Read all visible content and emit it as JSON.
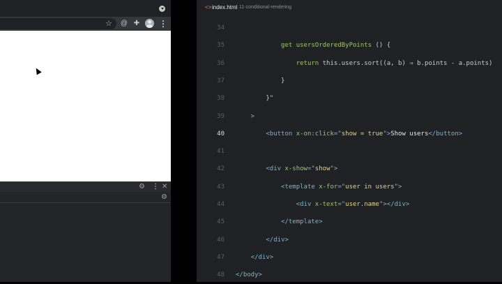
{
  "browser": {
    "omnibox_value": "",
    "icons": {
      "profile": "profile-dropdown-icon",
      "bookmark": "star-icon",
      "extension1": "at-icon",
      "extension2": "puzzle-icon",
      "account": "avatar-icon",
      "menu": "kebab-menu-icon"
    },
    "devtools": {
      "settings_icon": "gear-icon",
      "menu_icon": "kebab-menu-icon",
      "close_icon": "close-icon",
      "close_glyph": "✕",
      "settings_glyph": "⚙",
      "menu_glyph": "⋮"
    }
  },
  "editor": {
    "tab": {
      "icon": "<>",
      "filename": "index.html",
      "folder": "11-conditional-rendering"
    },
    "active_line": 40,
    "lines": [
      {
        "number": "34",
        "indent": 0,
        "tokens": []
      },
      {
        "number": "35",
        "indent": 0,
        "tokens": [
          {
            "t": "            ",
            "c": "plain"
          },
          {
            "t": "get ",
            "c": "attr"
          },
          {
            "t": "usersOrderedByPoints ",
            "c": "fn"
          },
          {
            "t": "() {",
            "c": "plain"
          }
        ]
      },
      {
        "number": "36",
        "indent": 0,
        "tokens": [
          {
            "t": "                ",
            "c": "plain"
          },
          {
            "t": "return ",
            "c": "attr"
          },
          {
            "t": "this.users.sort((a, b) ⇒ b.points - a.points)",
            "c": "plain"
          }
        ]
      },
      {
        "number": "37",
        "indent": 0,
        "tokens": [
          {
            "t": "            }",
            "c": "plain"
          }
        ]
      },
      {
        "number": "38",
        "indent": 0,
        "tokens": [
          {
            "t": "        }\"",
            "c": "plain"
          }
        ]
      },
      {
        "number": "39",
        "indent": 0,
        "tokens": [
          {
            "t": "    >",
            "c": "tag"
          }
        ]
      },
      {
        "number": "40",
        "indent": 0,
        "tokens": [
          {
            "t": "        ",
            "c": "plain"
          },
          {
            "t": "<button ",
            "c": "tag"
          },
          {
            "t": "x-on:click",
            "c": "attr"
          },
          {
            "t": "=\"",
            "c": "tag"
          },
          {
            "t": "show = true",
            "c": "str"
          },
          {
            "t": "\">",
            "c": "tag"
          },
          {
            "t": "Show users",
            "c": "white"
          },
          {
            "t": "</button>",
            "c": "tag"
          }
        ]
      },
      {
        "number": "41",
        "indent": 0,
        "tokens": []
      },
      {
        "number": "42",
        "indent": 0,
        "tokens": [
          {
            "t": "        ",
            "c": "plain"
          },
          {
            "t": "<div ",
            "c": "tag"
          },
          {
            "t": "x-show",
            "c": "attr"
          },
          {
            "t": "=\"",
            "c": "tag"
          },
          {
            "t": "show",
            "c": "str"
          },
          {
            "t": "\">",
            "c": "tag"
          }
        ]
      },
      {
        "number": "43",
        "indent": 0,
        "tokens": [
          {
            "t": "            ",
            "c": "plain"
          },
          {
            "t": "<template ",
            "c": "tag"
          },
          {
            "t": "x-for",
            "c": "attr"
          },
          {
            "t": "=\"",
            "c": "tag"
          },
          {
            "t": "user in users",
            "c": "str"
          },
          {
            "t": "\">",
            "c": "tag"
          }
        ]
      },
      {
        "number": "44",
        "indent": 0,
        "tokens": [
          {
            "t": "                ",
            "c": "plain"
          },
          {
            "t": "<div ",
            "c": "tag"
          },
          {
            "t": "x-text",
            "c": "attr"
          },
          {
            "t": "=\"",
            "c": "tag"
          },
          {
            "t": "user.name",
            "c": "str"
          },
          {
            "t": "\"></div>",
            "c": "tag"
          }
        ]
      },
      {
        "number": "45",
        "indent": 0,
        "tokens": [
          {
            "t": "            ",
            "c": "plain"
          },
          {
            "t": "</template>",
            "c": "tag"
          }
        ]
      },
      {
        "number": "46",
        "indent": 0,
        "tokens": [
          {
            "t": "        ",
            "c": "plain"
          },
          {
            "t": "</div>",
            "c": "tag"
          }
        ]
      },
      {
        "number": "47",
        "indent": 0,
        "tokens": [
          {
            "t": "    ",
            "c": "plain"
          },
          {
            "t": "</div>",
            "c": "tag"
          }
        ]
      },
      {
        "number": "48",
        "indent": 0,
        "tokens": [
          {
            "t": "</body>",
            "c": "tag"
          }
        ]
      }
    ]
  },
  "colors": {
    "editor_bg": "#1f2125",
    "tag": "#7fb3c9",
    "attr": "#a5c26c",
    "string": "#e4d584",
    "browser_chrome": "#35363a"
  }
}
